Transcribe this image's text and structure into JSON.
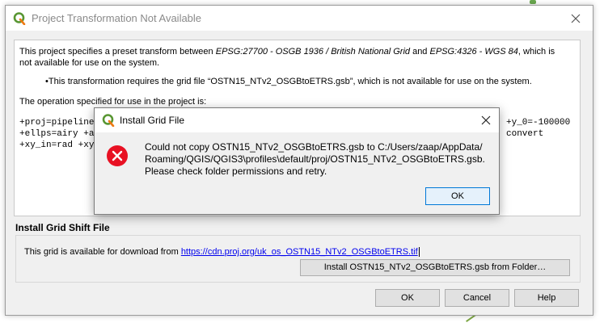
{
  "background": {
    "accent": "#6aa84f"
  },
  "main_dialog": {
    "title": "Project Transformation Not Available",
    "icon": "qgis-logo-icon",
    "para1_a": "This project specifies a preset transform between ",
    "crs_from": "EPSG:27700 - OSGB 1936 / British National Grid",
    "para1_b": " and ",
    "crs_to": "EPSG:4326 - WGS 84",
    "para1_c": ", which is not available for use on the system.",
    "bullet": "This transformation requires the grid file “OSTN15_NTv2_OSGBtoETRS.gsb”, which is not available for use on the system.",
    "para2": "The operation specified for use in the project is:",
    "code_line1": "+proj=pipeline",
    "code_line2": "+ellps=airy +a",
    "code_line3": "+xy_in=rad +xy",
    "code_right1": "+y_0=-100000",
    "code_right2": "convert",
    "section_title": "Install Grid Shift File",
    "avail_prefix": "This grid is available for download from ",
    "avail_link": "https://cdn.proj.org/uk_os_OSTN15_NTv2_OSGBtoETRS.tif",
    "folder_button": "Install OSTN15_NTv2_OSGBtoETRS.gsb from Folder…",
    "ok_button": "OK",
    "cancel_button": "Cancel",
    "help_button": "Help"
  },
  "error_dialog": {
    "title": "Install Grid File",
    "icon": "qgis-logo-icon",
    "error_icon": "error-icon",
    "error_color": "#e81123",
    "message_line1": "Could not copy OSTN15_NTv2_OSGBtoETRS.gsb to C:/Users/zaap/AppData/",
    "message_line2": "Roaming/QGIS/QGIS3\\profiles\\default/proj/OSTN15_NTv2_OSGBtoETRS.gsb.",
    "message_line3": "Please check folder permissions and retry.",
    "ok_button": "OK"
  }
}
